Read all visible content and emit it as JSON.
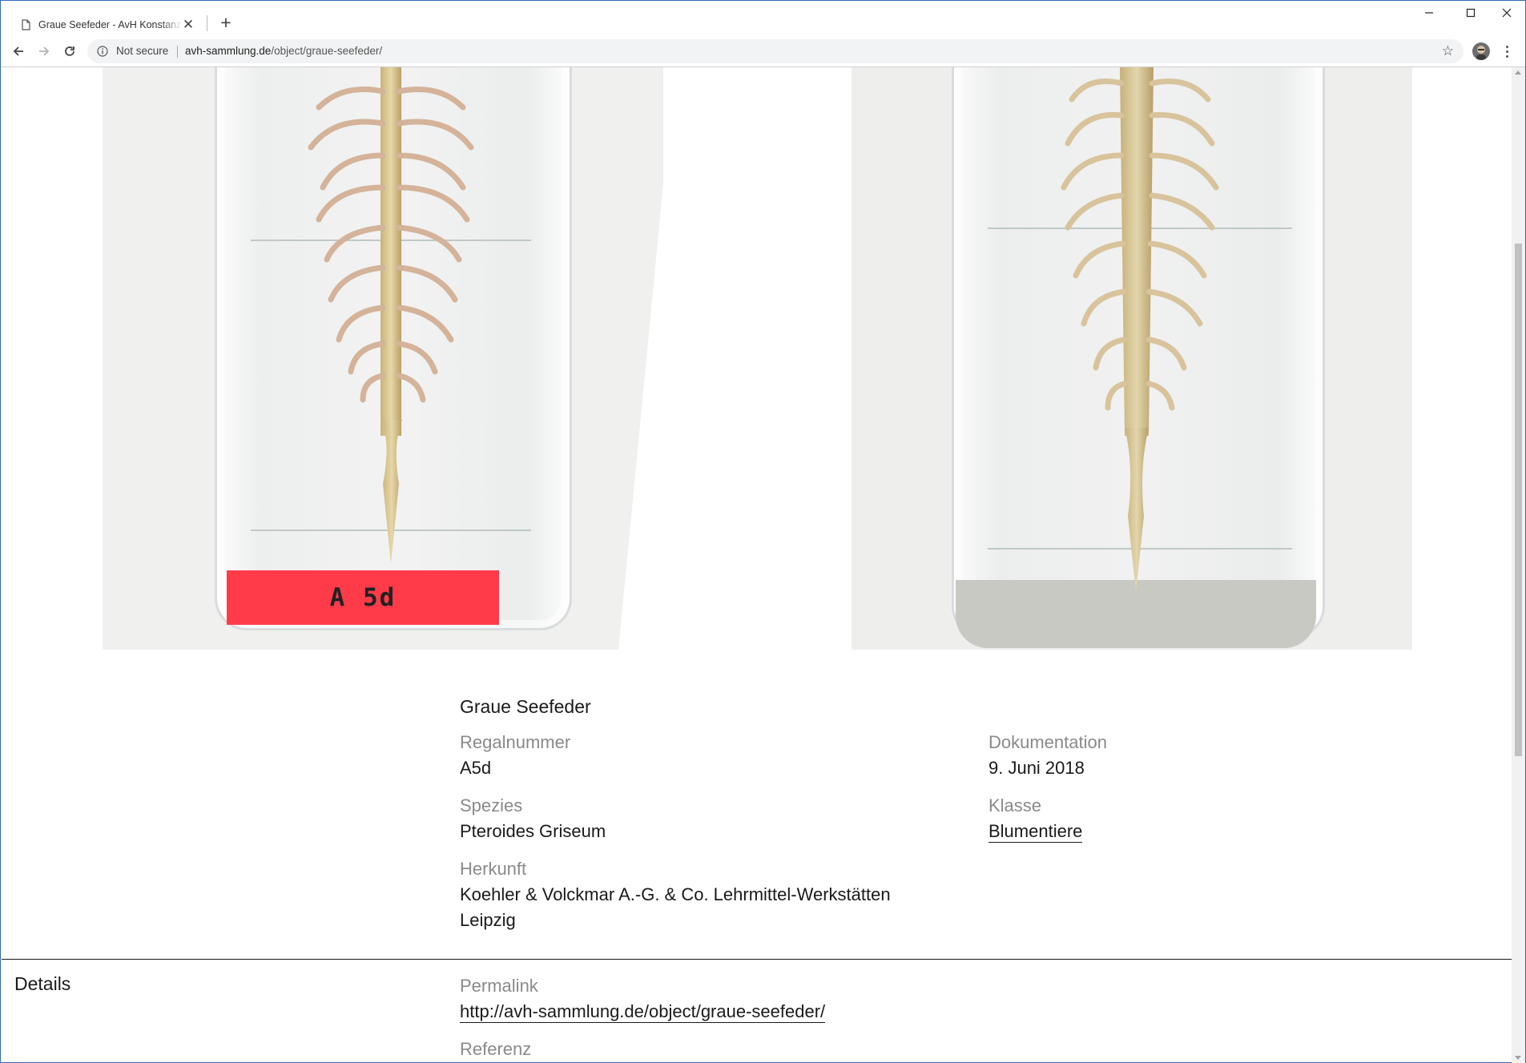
{
  "browser": {
    "tab_title": "Graue Seefeder - AvH Konstanz Lehrmittelsammlung",
    "new_tab_symbol": "+",
    "close_symbol": "✕",
    "security_text": "Not secure",
    "url_host": "avh-sammlung.de",
    "url_path": "/object/graue-seefeder/"
  },
  "photos": {
    "left_label": "A 5d"
  },
  "object": {
    "title": "Graue Seefeder",
    "regal_label": "Regalnummer",
    "regal_value": "A5d",
    "doku_label": "Dokumentation",
    "doku_value": "9. Juni 2018",
    "spezies_label": "Spezies",
    "spezies_value": "Pteroides Griseum",
    "klasse_label": "Klasse",
    "klasse_value": "Blumentiere",
    "herkunft_label": "Herkunft",
    "herkunft_value_line1": "Koehler & Volckmar A.-G. & Co. Lehrmittel-Werkstätten",
    "herkunft_value_line2": "Leipzig"
  },
  "details": {
    "heading": "Details",
    "permalink_label": "Permalink",
    "permalink_value": "http://avh-sammlung.de/object/graue-seefeder/",
    "referenz_label": "Referenz"
  },
  "colors": {
    "window_border": "#2f6db5",
    "label_red": "#ff3b4a",
    "label_grey": "#8a8a8a",
    "text": "#1a1a1a"
  }
}
